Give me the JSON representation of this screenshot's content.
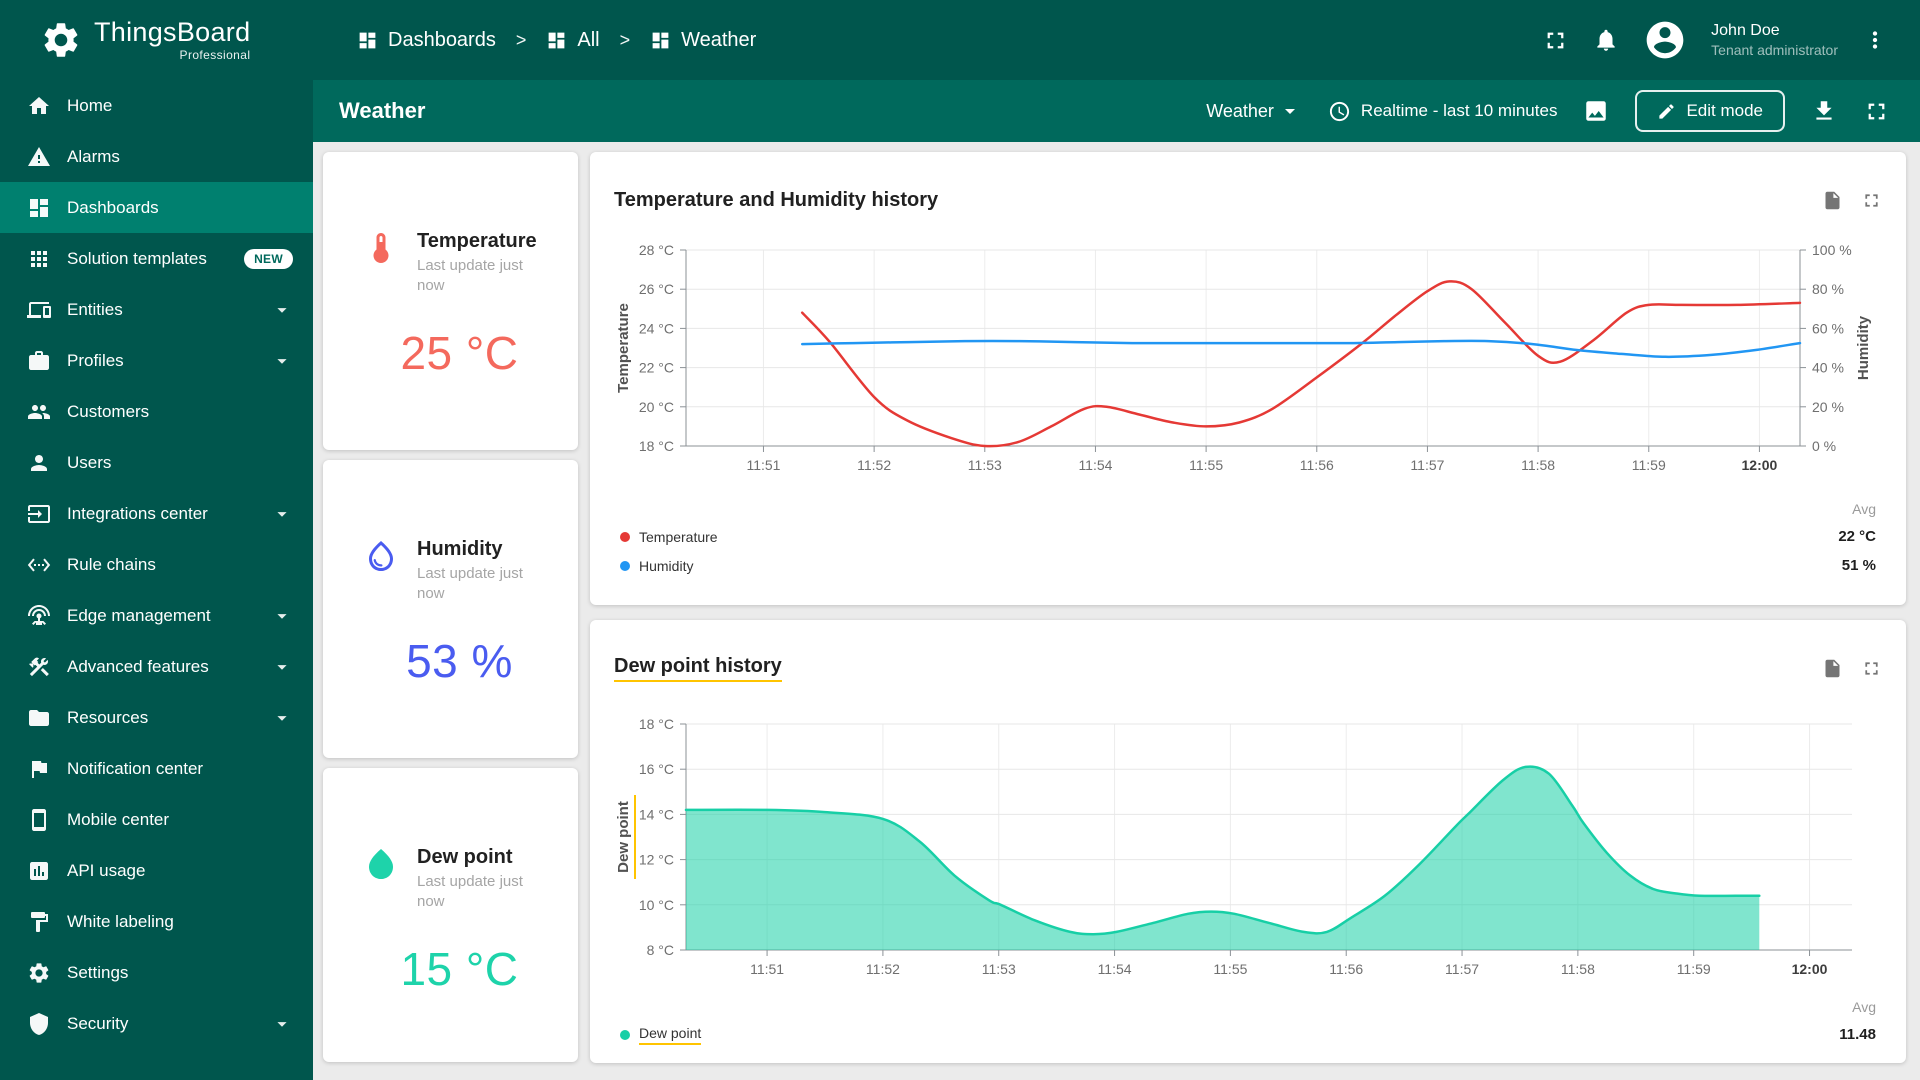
{
  "app": {
    "brand": "ThingsBoard",
    "brand_sub": "Professional"
  },
  "header": {
    "breadcrumb": [
      {
        "label": "Dashboards"
      },
      {
        "label": "All"
      },
      {
        "label": "Weather"
      }
    ],
    "user": {
      "name": "John Doe",
      "role": "Tenant administrator"
    }
  },
  "toolbar": {
    "title": "Weather",
    "state_selector": "Weather",
    "time_window": "Realtime - last 10 minutes",
    "edit_button": "Edit mode"
  },
  "sidebar": {
    "items": [
      {
        "label": "Home",
        "icon": "home"
      },
      {
        "label": "Alarms",
        "icon": "warning"
      },
      {
        "label": "Dashboards",
        "icon": "dashboards",
        "selected": true
      },
      {
        "label": "Solution templates",
        "icon": "apps",
        "badge": "NEW"
      },
      {
        "label": "Entities",
        "icon": "devices",
        "expandable": true
      },
      {
        "label": "Profiles",
        "icon": "work",
        "expandable": true
      },
      {
        "label": "Customers",
        "icon": "people"
      },
      {
        "label": "Users",
        "icon": "person"
      },
      {
        "label": "Integrations center",
        "icon": "input",
        "expandable": true
      },
      {
        "label": "Rule chains",
        "icon": "ethernet"
      },
      {
        "label": "Edge management",
        "icon": "antenna",
        "expandable": true
      },
      {
        "label": "Advanced features",
        "icon": "construction",
        "expandable": true
      },
      {
        "label": "Resources",
        "icon": "folder",
        "expandable": true
      },
      {
        "label": "Notification center",
        "icon": "flag"
      },
      {
        "label": "Mobile center",
        "icon": "phone"
      },
      {
        "label": "API usage",
        "icon": "chart"
      },
      {
        "label": "White labeling",
        "icon": "paint"
      },
      {
        "label": "Settings",
        "icon": "settings"
      },
      {
        "label": "Security",
        "icon": "shield",
        "expandable": true
      }
    ]
  },
  "value_cards": [
    {
      "title": "Temperature",
      "subtitle": "Last update just now",
      "value": "25 °C",
      "color": "#f4695d",
      "icon": "thermometer"
    },
    {
      "title": "Humidity",
      "subtitle": "Last update just now",
      "value": "53 %",
      "color": "#4a5cf0",
      "icon": "humidity"
    },
    {
      "title": "Dew point",
      "subtitle": "Last update just now",
      "value": "15 °C",
      "color": "#1ed3aa",
      "icon": "dew"
    }
  ],
  "chart_data": [
    {
      "type": "line",
      "title": "Temperature and Humidity history",
      "legend_position": "bottom-left",
      "grid": true,
      "avg_label": "Avg",
      "x": {
        "ticks": [
          "11:51",
          "11:52",
          "11:53",
          "11:54",
          "11:55",
          "11:56",
          "11:57",
          "11:58",
          "11:59",
          "12:00"
        ],
        "tick_t": [
          42,
          102,
          162,
          222,
          282,
          342,
          402,
          462,
          522,
          582
        ],
        "range": [
          0,
          604
        ]
      },
      "y_left": {
        "label": "Temperature",
        "range": [
          18,
          28
        ],
        "ticks": [
          "18 °C",
          "20 °C",
          "22 °C",
          "24 °C",
          "26 °C",
          "28 °C"
        ]
      },
      "y_right": {
        "label": "Humidity",
        "range": [
          0,
          100
        ],
        "ticks": [
          "0 %",
          "20 %",
          "40 %",
          "60 %",
          "80 %",
          "100 %"
        ]
      },
      "series": [
        {
          "name": "Temperature",
          "color": "#e53935",
          "axis": "left",
          "avg": "22 °C",
          "points": [
            [
              63,
              24.8
            ],
            [
              78,
              23.3
            ],
            [
              102,
              20.5
            ],
            [
              120,
              19.3
            ],
            [
              144,
              18.4
            ],
            [
              162,
              18.0
            ],
            [
              180,
              18.2
            ],
            [
              198,
              19.0
            ],
            [
              216,
              19.9
            ],
            [
              228,
              20.0
            ],
            [
              246,
              19.6
            ],
            [
              264,
              19.2
            ],
            [
              282,
              19.0
            ],
            [
              300,
              19.2
            ],
            [
              318,
              19.9
            ],
            [
              342,
              21.5
            ],
            [
              366,
              23.2
            ],
            [
              384,
              24.6
            ],
            [
              402,
              25.9
            ],
            [
              414,
              26.4
            ],
            [
              426,
              26.0
            ],
            [
              444,
              24.3
            ],
            [
              462,
              22.6
            ],
            [
              474,
              22.3
            ],
            [
              492,
              23.4
            ],
            [
              510,
              24.8
            ],
            [
              522,
              25.2
            ],
            [
              540,
              25.2
            ],
            [
              570,
              25.2
            ],
            [
              604,
              25.3
            ]
          ]
        },
        {
          "name": "Humidity",
          "color": "#2196f3",
          "axis": "right",
          "avg": "51 %",
          "points": [
            [
              63,
              52
            ],
            [
              91,
              52.5
            ],
            [
              121,
              53
            ],
            [
              151,
              53.5
            ],
            [
              181,
              53.5
            ],
            [
              211,
              53
            ],
            [
              242,
              52.5
            ],
            [
              272,
              52.5
            ],
            [
              302,
              52.5
            ],
            [
              332,
              52.5
            ],
            [
              362,
              52.5
            ],
            [
              386,
              53
            ],
            [
              411,
              53.5
            ],
            [
              435,
              53.5
            ],
            [
              459,
              52
            ],
            [
              483,
              49
            ],
            [
              507,
              47
            ],
            [
              531,
              45.5
            ],
            [
              556,
              46.5
            ],
            [
              580,
              49
            ],
            [
              604,
              52.5
            ]
          ]
        }
      ]
    },
    {
      "type": "area",
      "title": "Dew point history",
      "title_underline": true,
      "legend_position": "bottom-left",
      "grid": true,
      "avg_label": "Avg",
      "x": {
        "ticks": [
          "11:51",
          "11:52",
          "11:53",
          "11:54",
          "11:55",
          "11:56",
          "11:57",
          "11:58",
          "11:59",
          "12:00"
        ],
        "tick_t": [
          42,
          102,
          162,
          222,
          282,
          342,
          402,
          462,
          522,
          582
        ],
        "range": [
          0,
          604
        ]
      },
      "y_left": {
        "label": "Dew point",
        "underline": true,
        "range": [
          8,
          18
        ],
        "ticks": [
          "8 °C",
          "10 °C",
          "12 °C",
          "14 °C",
          "16 °C",
          "18 °C"
        ]
      },
      "series": [
        {
          "name": "Dew point",
          "color": "#17cfa6",
          "axis": "left",
          "avg": "11.48",
          "fill": true,
          "fill_opacity": 0.55,
          "underline": true,
          "points": [
            [
              0,
              14.2
            ],
            [
              42,
              14.2
            ],
            [
              72,
              14.1
            ],
            [
              102,
              13.8
            ],
            [
              121,
              12.8
            ],
            [
              139,
              11.3
            ],
            [
              157,
              10.2
            ],
            [
              163,
              10.0
            ],
            [
              181,
              9.3
            ],
            [
              199,
              8.8
            ],
            [
              211,
              8.7
            ],
            [
              223,
              8.8
            ],
            [
              242,
              9.2
            ],
            [
              260,
              9.6
            ],
            [
              272,
              9.7
            ],
            [
              284,
              9.6
            ],
            [
              302,
              9.2
            ],
            [
              320,
              8.8
            ],
            [
              332,
              8.8
            ],
            [
              344,
              9.4
            ],
            [
              362,
              10.4
            ],
            [
              380,
              11.8
            ],
            [
              399,
              13.5
            ],
            [
              405,
              14.0
            ],
            [
              423,
              15.5
            ],
            [
              435,
              16.1
            ],
            [
              447,
              15.8
            ],
            [
              459,
              14.4
            ],
            [
              465,
              13.6
            ],
            [
              477,
              12.3
            ],
            [
              489,
              11.3
            ],
            [
              501,
              10.7
            ],
            [
              513,
              10.5
            ],
            [
              525,
              10.4
            ],
            [
              544,
              10.4
            ],
            [
              556,
              10.4
            ]
          ]
        }
      ]
    }
  ]
}
